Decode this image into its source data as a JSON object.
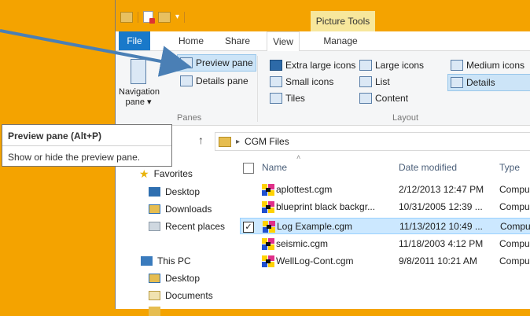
{
  "titlebar": {
    "contextual_label": "Picture Tools"
  },
  "ribbon_tabs": {
    "file": "File",
    "home": "Home",
    "share": "Share",
    "view": "View",
    "manage": "Manage"
  },
  "panes": {
    "navigation_pane": "Navigation pane",
    "navigation_pane_line1": "Navigation",
    "navigation_pane_line2": "pane ▾",
    "preview_pane": "Preview pane",
    "details_pane": "Details pane",
    "group_label": "Panes"
  },
  "layout": {
    "extra_large_icons": "Extra large icons",
    "large_icons": "Large icons",
    "medium_icons": "Medium icons",
    "small_icons": "Small icons",
    "list": "List",
    "details": "Details",
    "tiles": "Tiles",
    "content": "Content",
    "group_label": "Layout"
  },
  "tooltip": {
    "title": "Preview pane (Alt+P)",
    "description": "Show or hide the preview pane."
  },
  "address": {
    "path": "CGM Files"
  },
  "nav": {
    "favorites": "Favorites",
    "desktop": "Desktop",
    "downloads": "Downloads",
    "recent_places": "Recent places",
    "this_pc": "This PC",
    "pc_desktop": "Desktop",
    "documents": "Documents"
  },
  "columns": {
    "name": "Name",
    "date_modified": "Date modified",
    "type": "Type"
  },
  "files": [
    {
      "name": "aplottest.cgm",
      "date": "2/12/2013 12:47 PM",
      "type": "Compu"
    },
    {
      "name": "blueprint black backgr...",
      "date": "10/31/2005 12:39 ...",
      "type": "Compu"
    },
    {
      "name": "Log Example.cgm",
      "date": "11/13/2012 10:49 ...",
      "type": "Compu",
      "selected": true
    },
    {
      "name": "seismic.cgm",
      "date": "11/18/2003 4:12 PM",
      "type": "Compu"
    },
    {
      "name": "WellLog-Cont.cgm",
      "date": "9/8/2011 10:21 AM",
      "type": "Compu"
    }
  ],
  "colors": {
    "background": "#f4a300",
    "file_tab": "#1979ca",
    "arrow": "#4a7fb5",
    "selection": "#cce8ff"
  }
}
